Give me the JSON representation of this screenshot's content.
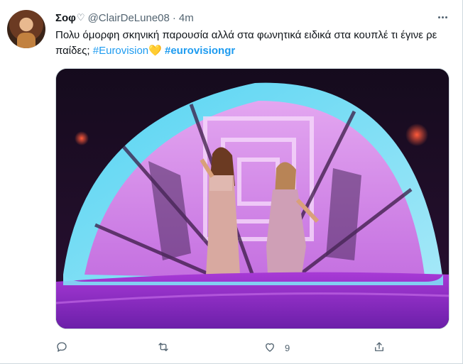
{
  "tweet": {
    "display_name": "Σοφ",
    "name_emoji": "♡",
    "handle": "@ClairDeLune08",
    "separator": "·",
    "time": "4m",
    "text_line": "Πολυ όμορφη σκηνική παρουσία αλλά στα φωνητικά ειδικά στα κουπλέ τι έγινε ρε παίδες;",
    "hashtag_1": "#Eurovision",
    "heart_emoji": "💛",
    "hashtag_2": "#eurovisiongr"
  },
  "actions": {
    "reply_icon": "reply-icon",
    "retweet_icon": "retweet-icon",
    "like_icon": "heart-icon",
    "like_count": "9",
    "share_icon": "share-icon"
  },
  "colors": {
    "link": "#1d9bf0",
    "secondary": "#536471"
  }
}
